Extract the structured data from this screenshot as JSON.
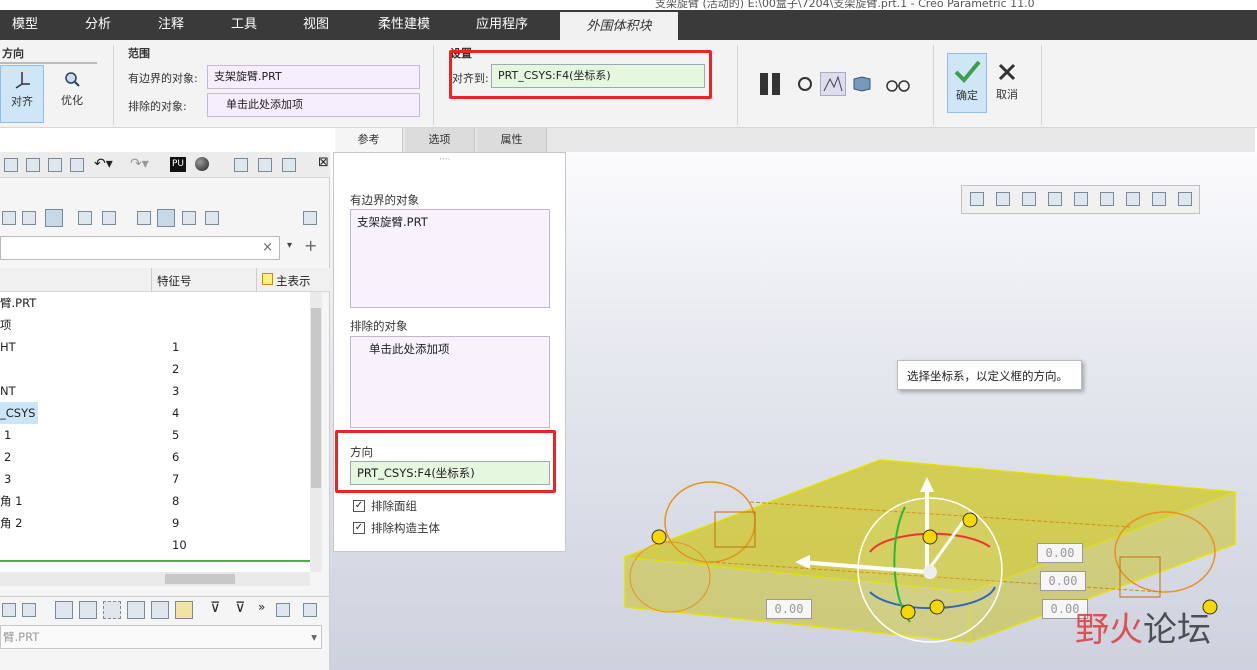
{
  "window": {
    "title": "支架旋臂 (活动的) E:\\00盒子\\7204\\支架旋臂.prt.1 - Creo Parametric 11.0"
  },
  "menubar": {
    "items": [
      "模型",
      "分析",
      "注释",
      "工具",
      "视图",
      "柔性建模",
      "应用程序",
      "外围体积块"
    ]
  },
  "ribbon": {
    "direction_title": "方向",
    "align_label": "对齐",
    "optimize_label": "优化",
    "range_title": "范围",
    "bounded_label": "有边界的对象:",
    "bounded_value": "支架旋臂.PRT",
    "excluded_label": "排除的对象:",
    "excluded_value": "单击此处添加项",
    "settings_title": "设置",
    "align_to_label": "对齐到:",
    "align_to_value": "PRT_CSYS:F4(坐标系)",
    "ok_label": "确定",
    "cancel_label": "取消"
  },
  "tabs": [
    "参考",
    "选项",
    "属性"
  ],
  "popup": {
    "grip": "····",
    "bounded_title": "有边界的对象",
    "bounded_value": "支架旋臂.PRT",
    "excluded_title": "排除的对象",
    "excluded_value": "单击此处添加项",
    "direction_title": "方向",
    "direction_value": "PRT_CSYS:F4(坐标系)",
    "check1": "排除面组",
    "check2": "排除构造主体"
  },
  "model_tree": {
    "search_clear": "×",
    "col_feature_id": "特征号",
    "col_main_rep": "主表示",
    "rows": [
      {
        "name": "臂.PRT",
        "id": ""
      },
      {
        "name": "项",
        "id": ""
      },
      {
        "name": "HT",
        "id": "1"
      },
      {
        "name": "",
        "id": "2"
      },
      {
        "name": "NT",
        "id": "3"
      },
      {
        "name": "_CSYS",
        "id": "4"
      },
      {
        "name": "1",
        "id": "5"
      },
      {
        "name": "2",
        "id": "6"
      },
      {
        "name": "3",
        "id": "7"
      },
      {
        "name": "角 1",
        "id": "8"
      },
      {
        "name": "角 2",
        "id": "9"
      },
      {
        "name": "",
        "id": "10"
      }
    ],
    "bottom_field": "臂.PRT"
  },
  "viewport": {
    "tooltip": "选择坐标系，以定义框的方向。",
    "dims": [
      "0.00",
      "0.00",
      "0.00",
      "0.00"
    ]
  },
  "watermark": {
    "part1": "野火",
    "part2": "论坛"
  },
  "colors": {
    "accent_red": "#e22222",
    "menubar": "#3a3a3a",
    "bbox_yellow": "#e8e000"
  }
}
